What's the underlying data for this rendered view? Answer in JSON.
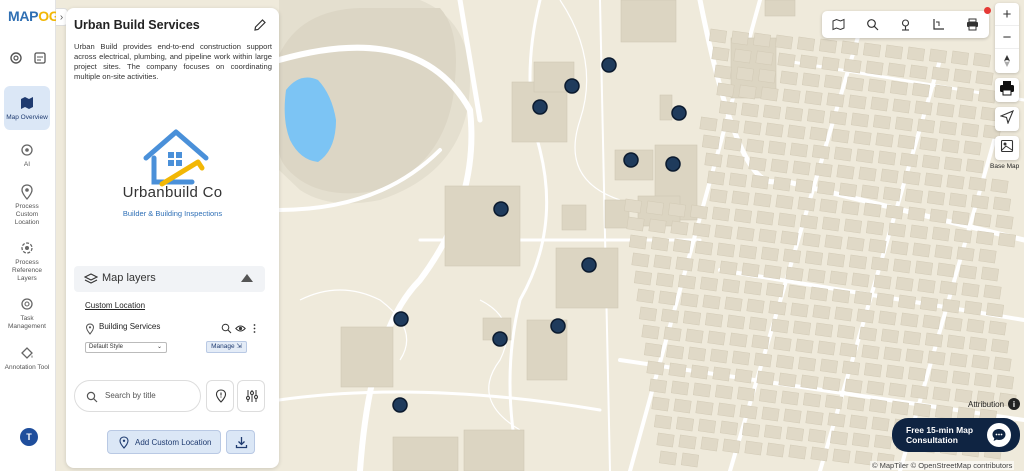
{
  "app": {
    "logo_main": "MAP",
    "logo_accent": "OG"
  },
  "rail": {
    "items": [
      {
        "label": "Map Overview",
        "icon": "map-icon",
        "active": true
      },
      {
        "label": "AI",
        "icon": "ai-icon",
        "active": false
      },
      {
        "label": "Process Custom Location",
        "icon": "location-pin-icon",
        "active": false
      },
      {
        "label": "Process Reference Layers",
        "icon": "layers-process-icon",
        "active": false
      },
      {
        "label": "Task Management",
        "icon": "task-gear-icon",
        "active": false
      },
      {
        "label": "Annotation Tool",
        "icon": "paint-bucket-icon",
        "active": false
      }
    ],
    "avatar_initial": "T"
  },
  "panel": {
    "title": "Urban Build Services",
    "description": "Urban Build provides end-to-end construction support across electrical, plumbing, and pipeline work within large project sites. The company focuses on coordinating multiple on-site activities.",
    "company_name": "Urbanbuild Co",
    "company_tagline": "Builder & Building Inspections",
    "layers": {
      "title": "Map layers",
      "custom_location_label": "Custom Location",
      "layer_name": "Building Services",
      "style_value": "Default Style",
      "manage_label": "Manage"
    },
    "search": {
      "placeholder": "Search by title"
    },
    "add_button_label": "Add Custom Location"
  },
  "map": {
    "basemap_label": "Base Map",
    "attribution_label": "Attribution",
    "consult_label": "Free 15-min Map Consultation",
    "credits": "© MapTiler © OpenStreetMap contributors",
    "marker_color": "#1f3b5c",
    "water_color": "#7cc4f4"
  },
  "colors": {
    "accent": "#2e6fb6",
    "dark_navy": "#0f2442"
  }
}
